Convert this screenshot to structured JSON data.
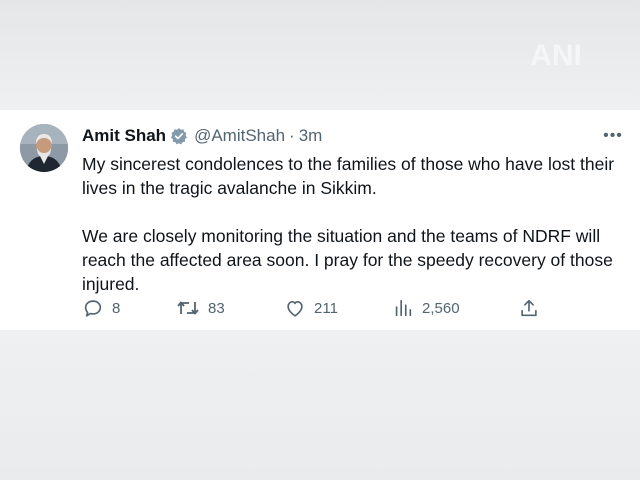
{
  "background": {
    "watermark": "ANI"
  },
  "tweet": {
    "author_name": "Amit Shah",
    "handle": "@AmitShah",
    "separator": "·",
    "time": "3m",
    "more_label": "•••",
    "paragraphs": [
      "My sincerest condolences to the families of those who have lost their lives in the tragic avalanche in Sikkim.",
      "We are closely monitoring the situation and the teams of NDRF will reach the affected area soon. I pray for the speedy recovery of those injured."
    ],
    "actions": {
      "replies": "8",
      "retweets": "83",
      "likes": "211",
      "views": "2,560"
    }
  },
  "icons": {
    "verified": "verified-badge-icon",
    "reply": "reply-icon",
    "retweet": "retweet-icon",
    "like": "heart-icon",
    "views": "views-chart-icon",
    "share": "share-icon"
  },
  "colors": {
    "text_primary": "#0f1419",
    "text_secondary": "#536471",
    "verified_badge": "#829aab",
    "card_bg": "#ffffff",
    "page_bg": "#eceef0"
  }
}
